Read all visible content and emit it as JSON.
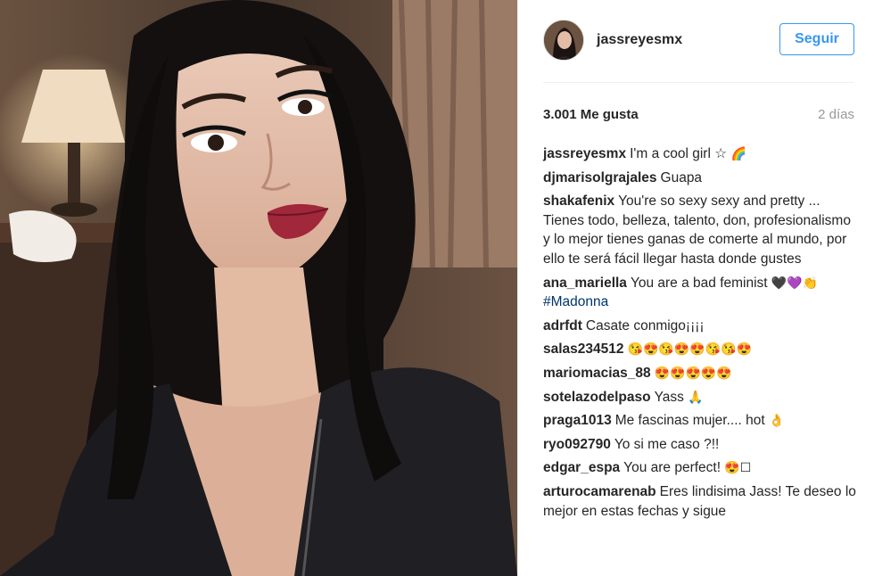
{
  "post": {
    "username": "jassreyesmx",
    "follow_label": "Seguir",
    "likes": "3.001 Me gusta",
    "time_ago": "2 días"
  },
  "comments": [
    {
      "user": "jassreyesmx",
      "text": "I'm a cool girl ☆",
      "emoji": "🌈"
    },
    {
      "user": "djmarisolgrajales",
      "text": "Guapa",
      "emoji": ""
    },
    {
      "user": "shakafenix",
      "text": "You're so sexy sexy and pretty ... Tienes todo, belleza, talento, don, profesionalismo y lo mejor tienes ganas de comerte al mundo, por ello te será fácil llegar hasta donde gustes",
      "emoji": ""
    },
    {
      "user": "ana_mariella",
      "text": "You are a bad feminist",
      "emoji": "🖤💜👏",
      "hashtag": "#Madonna"
    },
    {
      "user": "adrfdt",
      "text": "Casate conmigo¡¡¡¡",
      "emoji": ""
    },
    {
      "user": "salas234512",
      "text": "",
      "emoji": "😘😍😘😍😍😘😘😍"
    },
    {
      "user": "mariomacias_88",
      "text": "",
      "emoji": "😍😍😍😍😍"
    },
    {
      "user": "sotelazodelpaso",
      "text": "Yass",
      "emoji": "🙏"
    },
    {
      "user": "praga1013",
      "text": "Me fascinas mujer.... hot",
      "emoji": "👌"
    },
    {
      "user": "ryo092790",
      "text": "Yo si me caso ?!!",
      "emoji": ""
    },
    {
      "user": "edgar_espa",
      "text": "You are perfect!",
      "emoji": "😍☐"
    },
    {
      "user": "arturocamarenab",
      "text": "Eres lindisima Jass! Te deseo lo mejor en estas fechas y sigue",
      "emoji": ""
    }
  ],
  "colors": {
    "accent": "#3897f0",
    "text": "#262626",
    "muted": "#999999"
  }
}
